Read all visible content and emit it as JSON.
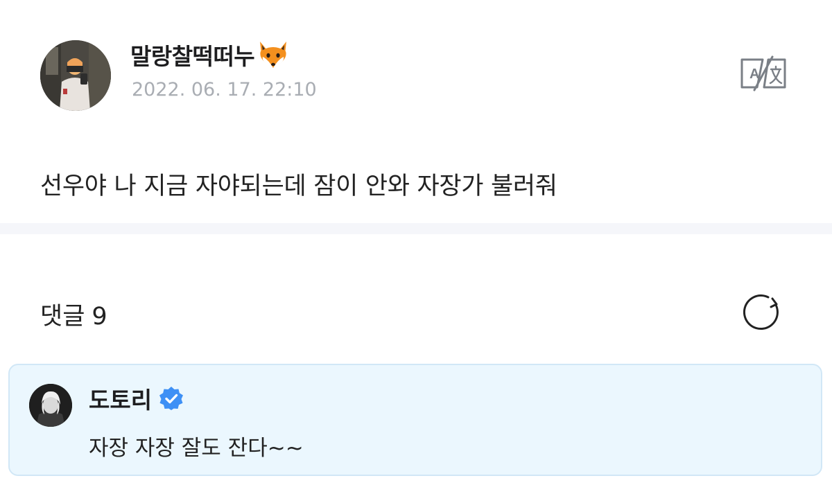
{
  "post": {
    "author": {
      "name": "말랑찰떡떠누",
      "emoji": "🦊",
      "avatar_icon": "profile-photo"
    },
    "timestamp": "2022. 06. 17. 22:10",
    "translate_icon": "translate-icon",
    "body": "선우야 나 지금 자야되는데 잠이 안와  자장가 불러줘"
  },
  "comments": {
    "label": "댓글",
    "count": "9",
    "refresh_icon": "refresh-icon",
    "items": [
      {
        "author": "도토리",
        "verified": true,
        "verified_icon": "verified-badge-icon",
        "text": "자장 자장 잘도 잔다~~"
      }
    ]
  },
  "colors": {
    "timestamp": "#a9adb3",
    "divider": "#f5f6fa",
    "comment_bg": "#ebf7fe",
    "comment_border": "#d1e7f6",
    "verified": "#3e90f5",
    "fox_orange": "#f4901e"
  }
}
